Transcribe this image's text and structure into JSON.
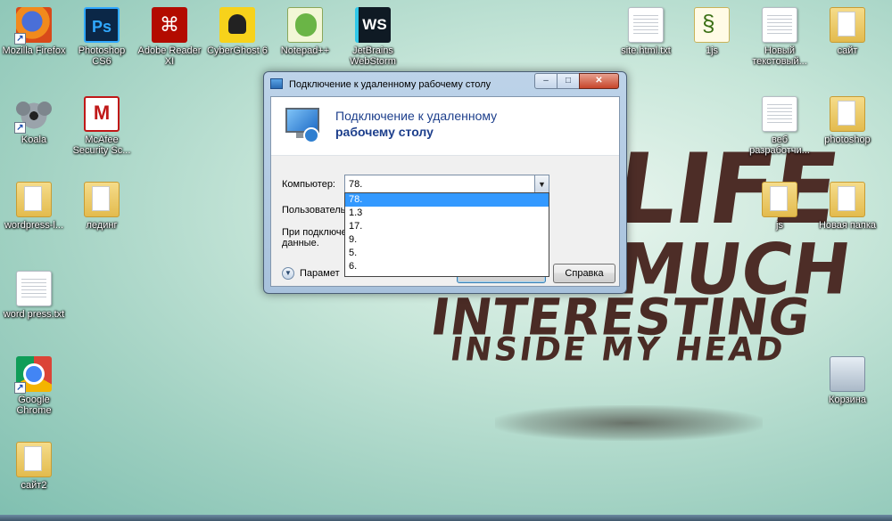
{
  "desktop_icons": [
    {
      "id": "firefox",
      "label": "Mozilla Firefox",
      "icon": "firefox-icon"
    },
    {
      "id": "photoshop",
      "label": "Photoshop CS6",
      "icon": "photoshop-icon",
      "glyph": "Ps"
    },
    {
      "id": "adobe",
      "label": "Adobe Reader XI",
      "icon": "adobe-reader-icon"
    },
    {
      "id": "cyberghost",
      "label": "CyberGhost 6",
      "icon": "cyberghost-icon"
    },
    {
      "id": "notepadpp",
      "label": "Notepad++",
      "icon": "notepadpp-icon"
    },
    {
      "id": "webstorm",
      "label": "JetBrains WebStorm",
      "icon": "webstorm-icon",
      "glyph": "WS"
    },
    {
      "id": "sitehtml",
      "label": "site.html.txt",
      "icon": "text-file-icon"
    },
    {
      "id": "ljs",
      "label": "1js",
      "icon": "script-file-icon"
    },
    {
      "id": "newtext",
      "label": "Новый текстовый...",
      "icon": "text-file-icon"
    },
    {
      "id": "sait",
      "label": "сайт",
      "icon": "folder-icon"
    },
    {
      "id": "koala",
      "label": "Koala",
      "icon": "koala-icon"
    },
    {
      "id": "mcafee",
      "label": "McAfee Security Sc...",
      "icon": "mcafee-icon",
      "glyph": "M"
    },
    {
      "id": "webdev",
      "label": "веб разработчи...",
      "icon": "text-file-icon"
    },
    {
      "id": "photoshopf",
      "label": "photoshop",
      "icon": "folder-icon"
    },
    {
      "id": "wordpressf",
      "label": "wordpress-l...",
      "icon": "folder-icon"
    },
    {
      "id": "landing",
      "label": "лединг",
      "icon": "folder-icon"
    },
    {
      "id": "jsf",
      "label": "js",
      "icon": "folder-icon"
    },
    {
      "id": "newfolder",
      "label": "Новая папка",
      "icon": "folder-icon"
    },
    {
      "id": "wptxt",
      "label": "word press.txt",
      "icon": "text-file-icon"
    },
    {
      "id": "chrome",
      "label": "Google Chrome",
      "icon": "chrome-icon"
    },
    {
      "id": "bin",
      "label": "Корзина",
      "icon": "recycle-bin-icon"
    },
    {
      "id": "sait2",
      "label": "сайт2",
      "icon": "folder-icon"
    }
  ],
  "wallpaper": {
    "words": [
      "LIFE",
      "MUCH",
      "INTERESTING",
      "INSIDE MY HEAD"
    ],
    "text_color": "#4a2b25"
  },
  "window": {
    "title": "Подключение к удаленному рабочему столу",
    "controls": {
      "minimize": "–",
      "maximize": "□",
      "close": "✕"
    },
    "banner": {
      "line1": "Подключение к удаленному",
      "line2": "рабочему столу"
    },
    "computer_label": "Компьютер:",
    "computer_value": "78.",
    "user_label": "Пользователь",
    "note": "При подключе данные.",
    "dropdown_items": [
      "78.",
      "1.3",
      "17.",
      "9.",
      "5.",
      "6."
    ],
    "selected_index": 0,
    "params_label": "Парамет",
    "connect_label": "",
    "help_label": "Справка",
    "accent": "#3399ff"
  }
}
